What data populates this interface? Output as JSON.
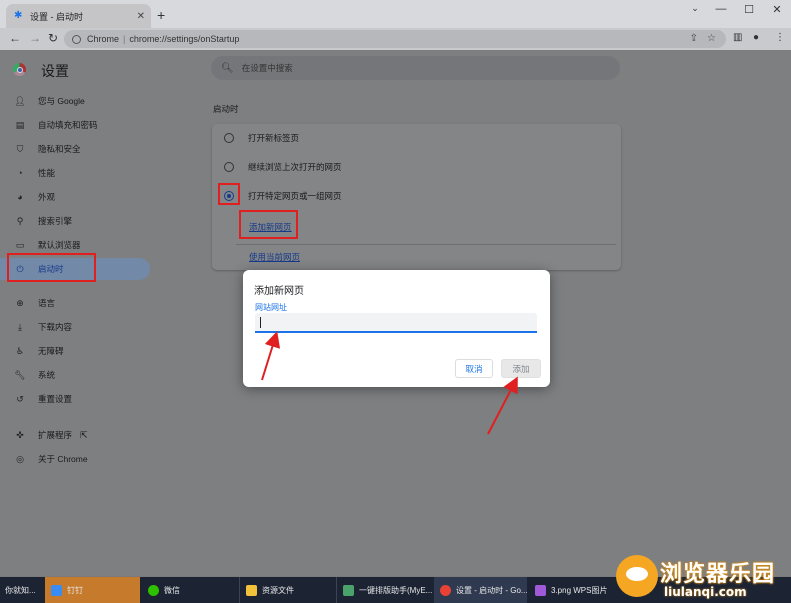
{
  "tab": {
    "title": "设置 - 启动时",
    "favicon": "gear-icon"
  },
  "omnibox": {
    "site": "Chrome",
    "separator": "|",
    "url": "chrome://settings/onStartup"
  },
  "header": {
    "title": "设置",
    "search_placeholder": "在设置中搜索"
  },
  "sidebar": {
    "items": [
      {
        "label": "您与 Google",
        "icon": "person-icon"
      },
      {
        "label": "自动填充和密码",
        "icon": "clipboard-icon"
      },
      {
        "label": "隐私和安全",
        "icon": "shield-icon"
      },
      {
        "label": "性能",
        "icon": "speedometer-icon"
      },
      {
        "label": "外观",
        "icon": "palette-icon"
      },
      {
        "label": "搜索引擎",
        "icon": "search-icon"
      },
      {
        "label": "默认浏览器",
        "icon": "browser-icon"
      },
      {
        "label": "启动时",
        "icon": "power-icon",
        "active": true
      },
      {
        "label": "语言",
        "icon": "globe-icon"
      },
      {
        "label": "下载内容",
        "icon": "download-icon"
      },
      {
        "label": "无障碍",
        "icon": "accessibility-icon"
      },
      {
        "label": "系统",
        "icon": "wrench-icon"
      },
      {
        "label": "重置设置",
        "icon": "reset-icon"
      },
      {
        "label": "扩展程序",
        "icon": "puzzle-icon"
      },
      {
        "label": "关于 Chrome",
        "icon": "chrome-icon"
      }
    ]
  },
  "startup": {
    "section_title": "启动时",
    "options": [
      {
        "label": "打开新标签页",
        "checked": false
      },
      {
        "label": "继续浏览上次打开的网页",
        "checked": false
      },
      {
        "label": "打开特定网页或一组网页",
        "checked": true
      }
    ],
    "add_page_link": "添加新网页",
    "use_current_link": "使用当前网页"
  },
  "dialog": {
    "title": "添加新网页",
    "field_label": "网站网址",
    "field_value": "",
    "cancel_label": "取消",
    "add_label": "添加"
  },
  "taskbar": {
    "items": [
      {
        "label": "你就知...",
        "color": "#1c2434"
      },
      {
        "label": "钉钉",
        "color": "#3a8cf5",
        "highlight": true
      },
      {
        "label": "微信",
        "color": "#2dc100"
      },
      {
        "label": "资源文件",
        "color": "#f3c23b"
      },
      {
        "label": "一键排版助手(MyE...",
        "color": "#4aa36b"
      },
      {
        "label": "设置 - 启动时 - Go...",
        "color": "#e94235",
        "active": true
      },
      {
        "label": "3.png   WPS图片",
        "color": "#a05ad8"
      }
    ]
  },
  "watermark": {
    "text": "浏览器乐园",
    "url": "liulanqi.com"
  },
  "colors": {
    "accent": "#1a73e8",
    "annotation": "#e02020",
    "taskbar": "#1c2434"
  }
}
